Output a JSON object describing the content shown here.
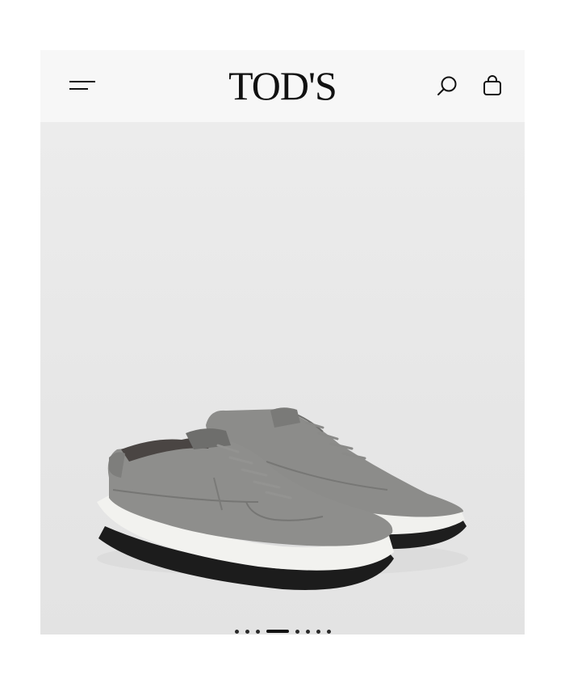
{
  "header": {
    "brand_logo": "TOD'S",
    "menu_icon": "hamburger-menu-icon",
    "search_icon": "search-icon",
    "bag_icon": "shopping-bag-icon"
  },
  "product": {
    "image_icon": "grey-suede-sneakers-image"
  },
  "carousel": {
    "total_slides": 8,
    "active_index": 3
  },
  "colors": {
    "header_bg": "#f7f7f7",
    "image_bg": "#e8e8e8",
    "text": "#111111"
  }
}
